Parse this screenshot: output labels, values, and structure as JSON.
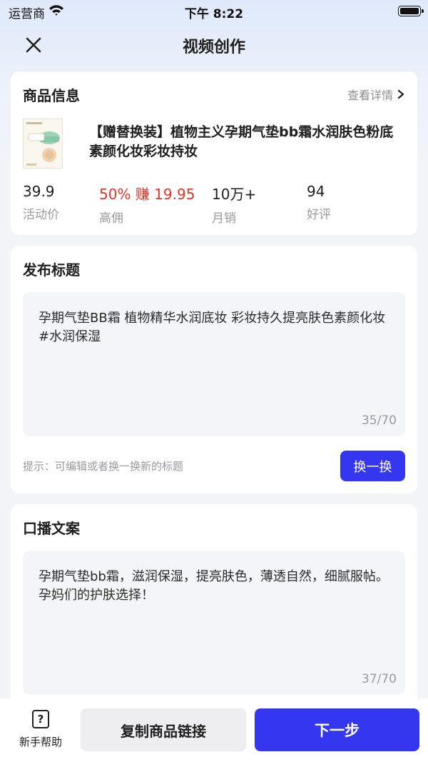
{
  "status_bar": {
    "carrier": "运营商",
    "time": "下午 8:22"
  },
  "nav": {
    "title": "视频创作"
  },
  "product": {
    "section_title": "商品信息",
    "detail_link": "查看详情",
    "title": "【赠替换装】植物主义孕期气垫bb霜水润肤色粉底素颜化妆彩妆持妆",
    "stats": [
      {
        "value": "39.9",
        "label": "活动价"
      },
      {
        "value": "50% 赚 19.95",
        "label": "高佣",
        "color": "#e5332a"
      },
      {
        "value": "10万+",
        "label": "月销"
      },
      {
        "value": "94",
        "label": "好评"
      }
    ]
  },
  "publish_title": {
    "section_title": "发布标题",
    "text": "孕期气垫BB霜 植物精华水润底妆 彩妆持久提亮肤色素颜化妆#水润保湿",
    "counter": "35/70",
    "hint": "提示：可编辑或者换一换新的标题",
    "swap_label": "换一换"
  },
  "script": {
    "section_title": "口播文案",
    "text": "孕期气垫bb霜，滋润保湿，提亮肤色，薄透自然，细腻服帖。孕妈们的护肤选择！",
    "counter": "37/70"
  },
  "bottom": {
    "help_label": "新手帮助",
    "help_icon_glyph": "?",
    "copy_label": "复制商品链接",
    "next_label": "下一步"
  },
  "colors": {
    "accent": "#3436f0",
    "commission": "#e5332a"
  }
}
